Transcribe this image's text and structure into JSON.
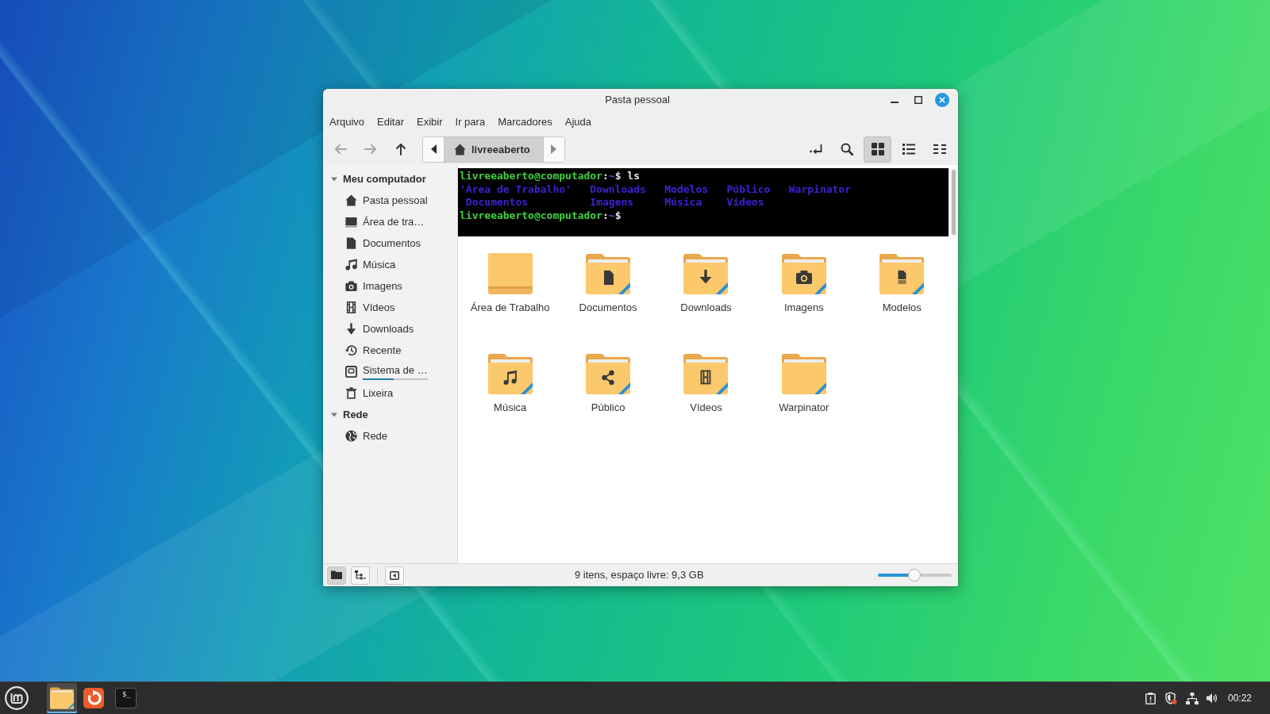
{
  "window": {
    "title": "Pasta pessoal"
  },
  "menu": [
    "Arquivo",
    "Editar",
    "Exibir",
    "Ir para",
    "Marcadores",
    "Ajuda"
  ],
  "navigation": [
    {
      "kind": "back",
      "disabled": true
    },
    {
      "kind": "forward",
      "disabled": true
    },
    {
      "kind": "up",
      "disabled": false
    }
  ],
  "path_bar": {
    "segments": [
      {
        "kind": "home",
        "label": "livreeaberto",
        "selected": true
      }
    ]
  },
  "views": [
    {
      "kind": "icons",
      "selected": true
    },
    {
      "kind": "list",
      "selected": false
    },
    {
      "kind": "compact",
      "selected": false
    }
  ],
  "sidebar": {
    "sections": [
      {
        "title": "Meu computador",
        "expanded": true,
        "items": [
          {
            "kind": "home",
            "label": "Pasta pessoal",
            "selected": false
          },
          {
            "kind": "desktop",
            "label": "Área de tra…",
            "selected": false
          },
          {
            "kind": "documents",
            "label": "Documentos",
            "selected": false
          },
          {
            "kind": "music",
            "label": "Música",
            "selected": false
          },
          {
            "kind": "pictures",
            "label": "Imagens",
            "selected": false
          },
          {
            "kind": "videos",
            "label": "Vídeos",
            "selected": false
          },
          {
            "kind": "downloads",
            "label": "Downloads",
            "selected": false
          },
          {
            "kind": "recent",
            "label": "Recente",
            "selected": false
          },
          {
            "kind": "filesystem",
            "label": "Sistema de …",
            "selected": false,
            "level": 0.48
          },
          {
            "kind": "trash",
            "label": "Lixeira",
            "selected": false
          }
        ]
      },
      {
        "title": "Rede",
        "expanded": true,
        "items": [
          {
            "kind": "network",
            "label": "Rede",
            "selected": false
          }
        ]
      }
    ]
  },
  "terminal": {
    "lines": [
      {
        "kind": "prompt",
        "user": "livreeaberto@computador",
        "separator": ":",
        "path": "~",
        "symbol": "$",
        "command": "ls"
      },
      {
        "kind": "listing",
        "entries": [
          "'Área de Trabalho'",
          "Downloads",
          "Modelos",
          "Público",
          "Warpinator"
        ]
      },
      {
        "kind": "listing",
        "entries": [
          " Documentos",
          "Imagens",
          "Música",
          "Vídeos"
        ]
      },
      {
        "kind": "prompt",
        "user": "livreeaberto@computador",
        "separator": ":",
        "path": "~",
        "symbol": "$"
      }
    ]
  },
  "files": [
    {
      "kind": "desktop",
      "name": "Área de Trabalho",
      "selected": false
    },
    {
      "kind": "documents",
      "name": "Documentos",
      "selected": false
    },
    {
      "kind": "downloads",
      "name": "Downloads",
      "selected": false
    },
    {
      "kind": "pictures",
      "name": "Imagens",
      "selected": false
    },
    {
      "kind": "templates",
      "name": "Modelos",
      "selected": false
    },
    {
      "kind": "music",
      "name": "Música",
      "selected": false
    },
    {
      "kind": "public",
      "name": "Público",
      "selected": false
    },
    {
      "kind": "videos",
      "name": "Vídeos",
      "selected": false
    },
    {
      "kind": "folder",
      "name": "Warpinator",
      "selected": false
    }
  ],
  "status_bar": {
    "panes": [
      {
        "kind": "places",
        "selected": true
      },
      {
        "kind": "tree",
        "selected": false
      }
    ],
    "text": "9 itens, espaço livre: 9,3 GB",
    "zoom": {
      "level": 0.49
    }
  },
  "taskbar": {
    "launchers": [
      {
        "kind": "files",
        "active": true
      },
      {
        "kind": "browser",
        "active": false
      },
      {
        "kind": "terminal",
        "active": false,
        "label": "$_"
      }
    ],
    "clock": "00:22"
  }
}
